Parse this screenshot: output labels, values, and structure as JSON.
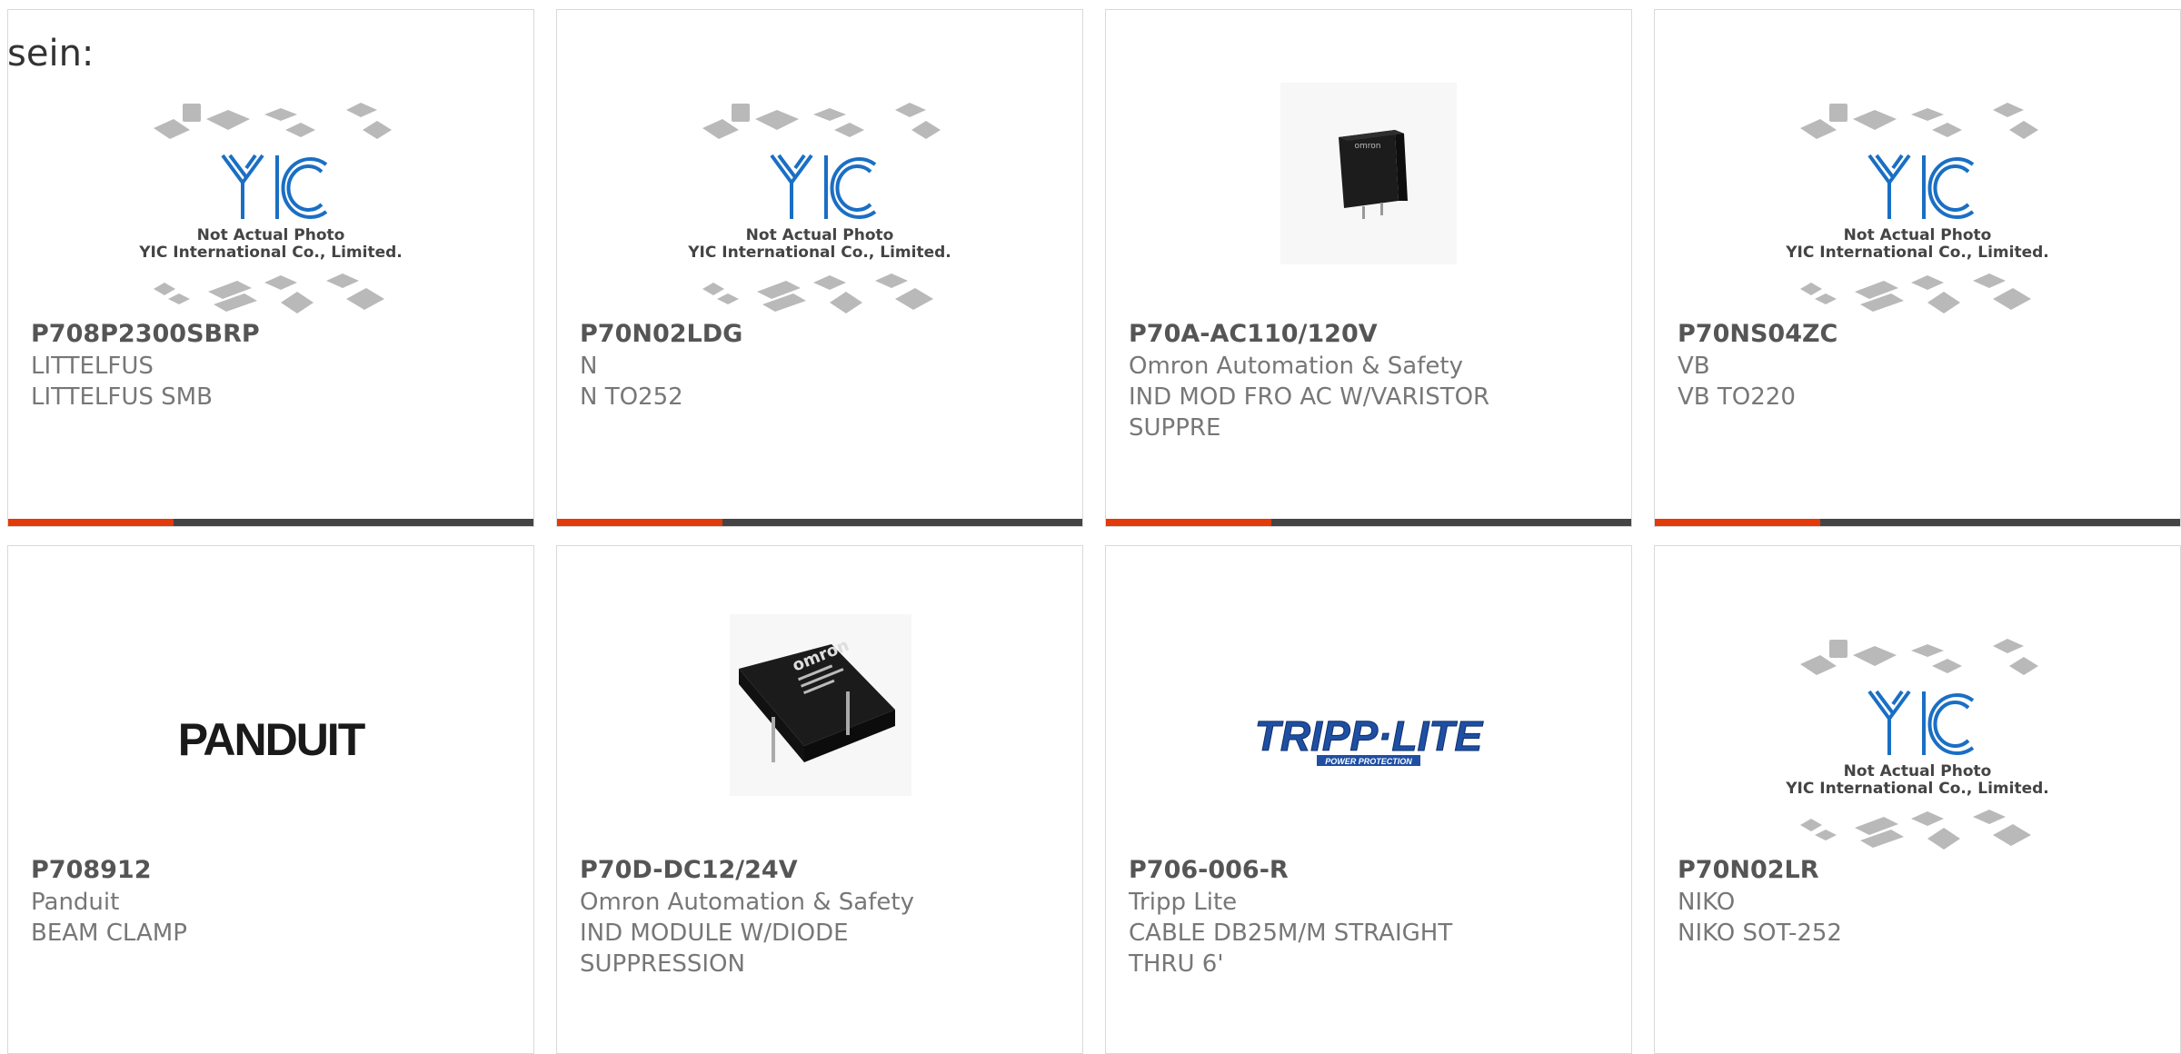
{
  "intro": "sein:",
  "placeholder_caption": [
    "Not Actual Photo",
    "YIC International Co., Limited."
  ],
  "placeholder_logo": "YIC",
  "brand_logos": {
    "panduit": "PANDUIT",
    "tripplite": "TRIPP·LITE",
    "tripplite_sub": "POWER PROTECTION",
    "omron": "omron"
  },
  "colors": {
    "accent": "#e23a0a",
    "bar": "#444444",
    "yic_blue": "#1a6fc4"
  },
  "products": [
    {
      "part": "P708P2300SBRP",
      "maker": "LITTELFUS",
      "desc": "LITTELFUS SMB",
      "desc2": "",
      "image": "yic-placeholder"
    },
    {
      "part": "P70N02LDG",
      "maker": "N",
      "desc": "N TO252",
      "desc2": "",
      "image": "yic-placeholder"
    },
    {
      "part": "P70A-AC110/120V",
      "maker": "Omron Automation & Safety",
      "desc": "IND MOD FRO AC W/VARISTOR",
      "desc2": "SUPPRE",
      "image": "omron-relay-small"
    },
    {
      "part": "P70NS04ZC",
      "maker": "VB",
      "desc": "VB TO220",
      "desc2": "",
      "image": "yic-placeholder"
    },
    {
      "part": "P708912",
      "maker": "Panduit",
      "desc": "BEAM CLAMP",
      "desc2": "",
      "image": "panduit-logo"
    },
    {
      "part": "P70D-DC12/24V",
      "maker": "Omron Automation & Safety",
      "desc": "IND MODULE W/DIODE",
      "desc2": "SUPPRESSION",
      "image": "omron-relay-large"
    },
    {
      "part": "P706-006-R",
      "maker": "Tripp Lite",
      "desc": "CABLE DB25M/M STRAIGHT",
      "desc2": "THRU 6'",
      "image": "tripplite-logo"
    },
    {
      "part": "P70N02LR",
      "maker": "NIKO",
      "desc": "NIKO SOT-252",
      "desc2": "",
      "image": "yic-placeholder"
    }
  ]
}
